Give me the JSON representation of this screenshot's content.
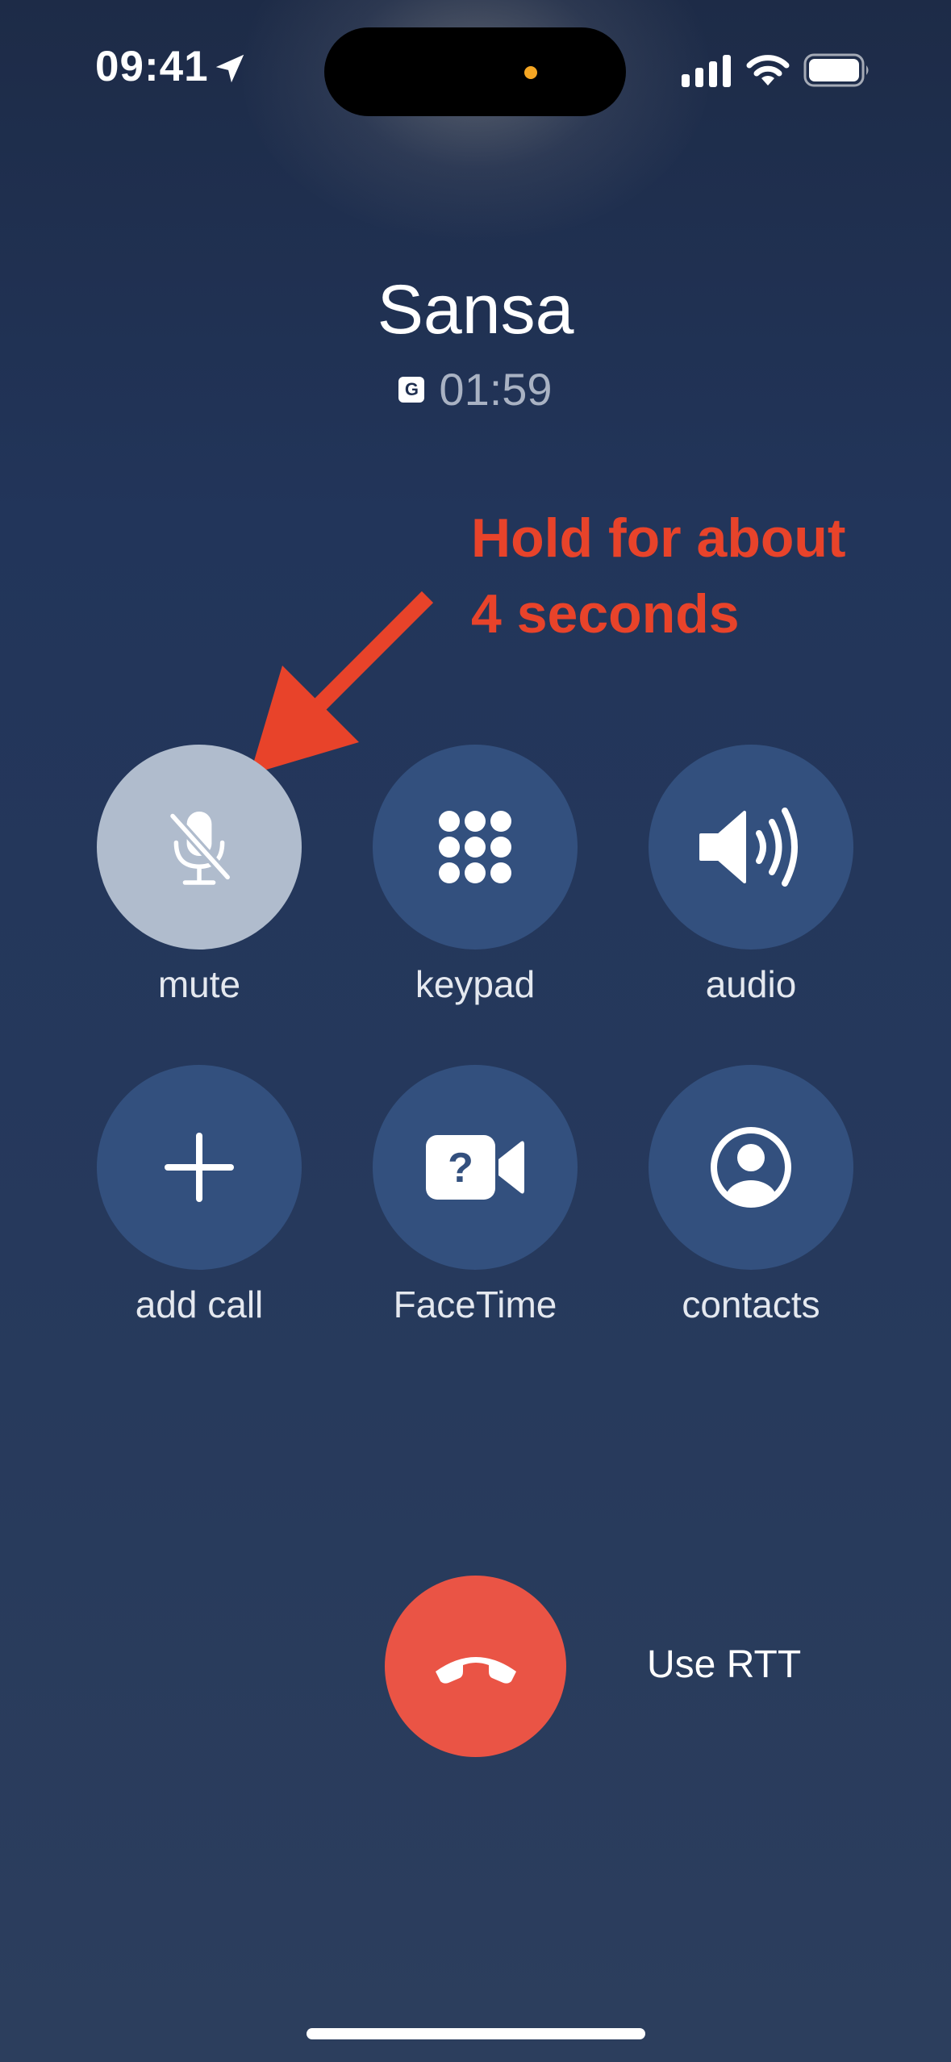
{
  "status_bar": {
    "time": "09:41",
    "icons": [
      "location-arrow-icon",
      "cellular-signal-icon",
      "wifi-icon",
      "battery-icon"
    ]
  },
  "call": {
    "caller_name": "Sansa",
    "badge": "G",
    "duration": "01:59"
  },
  "annotation": {
    "line1": "Hold for about",
    "line2": "4 seconds",
    "color": "#e8432a"
  },
  "controls": [
    {
      "label": "mute",
      "icon": "microphone-slash-icon",
      "active": true
    },
    {
      "label": "keypad",
      "icon": "keypad-icon",
      "active": false
    },
    {
      "label": "audio",
      "icon": "speaker-icon",
      "active": false
    },
    {
      "label": "add call",
      "icon": "plus-icon",
      "active": false
    },
    {
      "label": "FaceTime",
      "icon": "facetime-question-icon",
      "active": false
    },
    {
      "label": "contacts",
      "icon": "person-circle-icon",
      "active": false
    }
  ],
  "end_call": {
    "icon": "phone-hangup-icon",
    "color": "#ea5445"
  },
  "rtt_label": "Use RTT",
  "colors": {
    "button_bg": "#33507e",
    "active_button_bg": "#b0bccd",
    "background": "#22355a"
  }
}
